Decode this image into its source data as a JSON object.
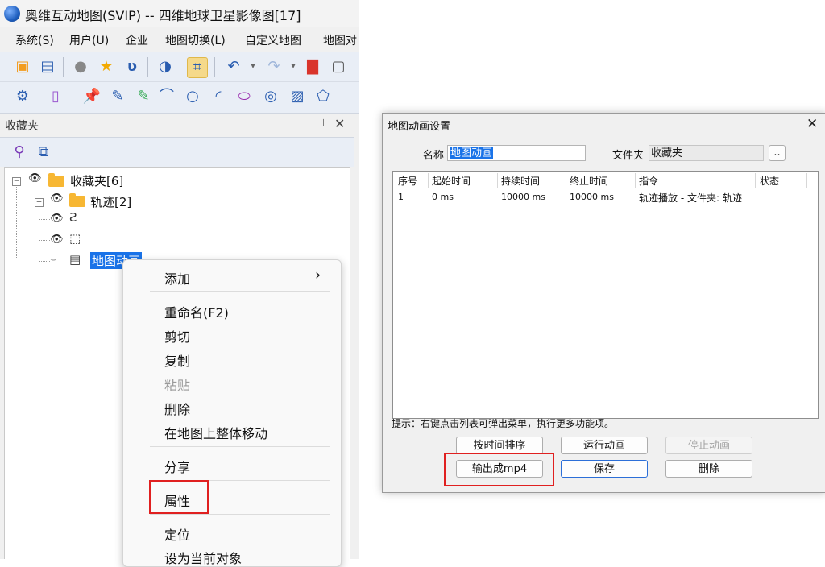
{
  "app": {
    "title": "奥维互动地图(SVIP) -- 四维地球卫星影像图[17]",
    "menu": [
      "系统(S)",
      "用户(U)",
      "企业",
      "地图切换(L)",
      "自定义地图",
      "地图对"
    ]
  },
  "panel": {
    "title": "收藏夹",
    "pin_icon": "pin-icon",
    "close_icon": "close-icon"
  },
  "tree": {
    "root_label": "收藏夹[6]",
    "child_folder_label": "轨迹[2]",
    "selected_label": "地图动画"
  },
  "context_menu": {
    "add": "添加",
    "add_arrow": "›",
    "rename": "重命名(F2)",
    "cut": "剪切",
    "copy": "复制",
    "paste": "粘贴",
    "delete": "删除",
    "move": "在地图上整体移动",
    "share": "分享",
    "properties": "属性",
    "locate": "定位",
    "set_current": "设为当前对象"
  },
  "dialog": {
    "title": "地图动画设置",
    "close": "✕",
    "name_label": "名称",
    "name_value": "地图动画",
    "folder_label": "文件夹",
    "folder_value": "收藏夹",
    "browse": "..",
    "columns": [
      "序号",
      "起始时间",
      "持续时间",
      "终止时间",
      "指令",
      "状态"
    ],
    "rows": [
      [
        "1",
        "0 ms",
        "10000 ms",
        "10000 ms",
        "轨迹播放 - 文件夹: 轨迹",
        ""
      ]
    ],
    "hint": "提示：右键点击列表可弹出菜单，执行更多功能项。",
    "buttons": {
      "sort": "按时间排序",
      "run": "运行动画",
      "stop": "停止动画",
      "export": "输出成mp4",
      "save": "保存",
      "delete": "删除"
    }
  },
  "colors": {
    "highlight": "#e02020",
    "selection": "#1a73e8"
  }
}
